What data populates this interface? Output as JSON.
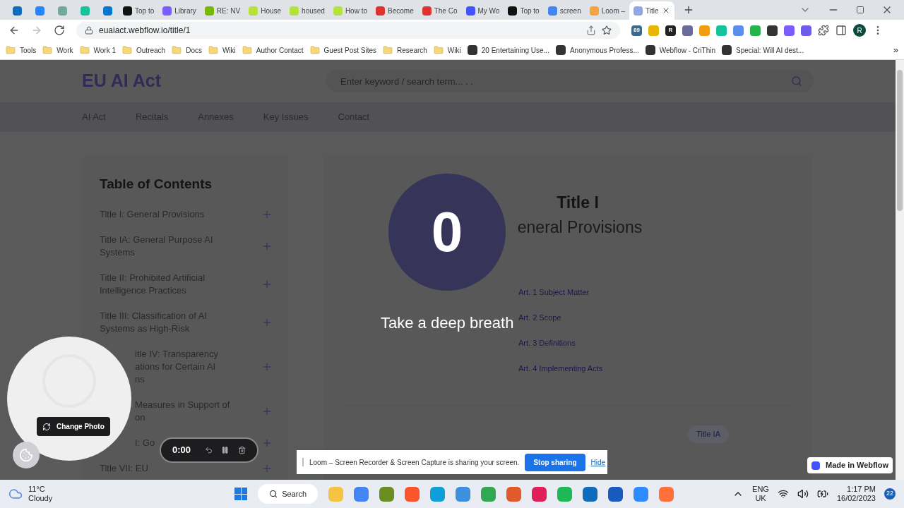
{
  "browser": {
    "tabs": [
      {
        "selected": false,
        "color": "#0f6cbd"
      },
      {
        "selected": false,
        "color": "#2684ff"
      },
      {
        "selected": false,
        "color": "#74aa9c"
      },
      {
        "selected": false,
        "color": "#15c39a"
      },
      {
        "selected": false,
        "color": "#0078d4"
      },
      {
        "label": "Top to",
        "selected": false,
        "color": "#111111"
      },
      {
        "label": "Library",
        "selected": false,
        "color": "#7c5cff"
      },
      {
        "label": "RE: NV",
        "selected": false,
        "color": "#76b900"
      },
      {
        "label": "House",
        "selected": false,
        "color": "#b7e23a"
      },
      {
        "label": "housed",
        "selected": false,
        "color": "#b7e23a"
      },
      {
        "label": "How to",
        "selected": false,
        "color": "#b7e23a"
      },
      {
        "label": "Become",
        "selected": false,
        "color": "#e0332e"
      },
      {
        "label": "The Co",
        "selected": false,
        "color": "#e0332e"
      },
      {
        "label": "My Wo",
        "selected": false,
        "color": "#4353ff"
      },
      {
        "label": "Top to",
        "selected": false,
        "color": "#111111"
      },
      {
        "label": "screen",
        "selected": false,
        "color": "#4285f4"
      },
      {
        "label": "Loom –",
        "selected": false,
        "color": "#f4a340"
      },
      {
        "label": "Title",
        "selected": true,
        "color": "#8fa6e8"
      }
    ],
    "address": "euaiact.webflow.io/title/1",
    "extensions": [
      {
        "label": "89",
        "color": "#3a6b8c"
      },
      {
        "color": "#e8b500"
      },
      {
        "label": "R",
        "color": "#222222"
      },
      {
        "color": "#6b6b9a"
      },
      {
        "color": "#f39c12"
      },
      {
        "color": "#15c39a"
      },
      {
        "color": "#5b8def"
      },
      {
        "color": "#25b34b"
      },
      {
        "color": "#333333"
      },
      {
        "color": "#7b5cff"
      },
      {
        "color": "#6c5ce7"
      }
    ],
    "profile": "R",
    "bookmarks": [
      {
        "label": "Tools",
        "kind": "folder"
      },
      {
        "label": "Work",
        "kind": "folder"
      },
      {
        "label": "Work 1",
        "kind": "folder"
      },
      {
        "label": "Outreach",
        "kind": "folder"
      },
      {
        "label": "Docs",
        "kind": "folder"
      },
      {
        "label": "Wiki",
        "kind": "folder"
      },
      {
        "label": "Author Contact",
        "kind": "folder"
      },
      {
        "label": "Guest Post Sites",
        "kind": "folder"
      },
      {
        "label": "Research",
        "kind": "folder"
      },
      {
        "label": "Wiki",
        "kind": "folder"
      },
      {
        "label": "20 Entertaining Use...",
        "kind": "site"
      },
      {
        "label": "Anonymous Profess...",
        "kind": "site"
      },
      {
        "label": "Webflow - CriThin",
        "kind": "site"
      },
      {
        "label": "Special: Will AI dest...",
        "kind": "site"
      }
    ],
    "more_bookmarks": "»"
  },
  "site": {
    "logo": "EU AI Act",
    "search": {
      "placeholder": "Enter keyword / search term... . ."
    },
    "nav": [
      "AI Act",
      "Recitals",
      "Annexes",
      "Key Issues",
      "Contact"
    ],
    "toc": {
      "title": "Table of Contents",
      "items": [
        {
          "kind": "full",
          "lines": [
            "Title I: General Provisions"
          ]
        },
        {
          "kind": "full",
          "lines": [
            "Title IA: General Purpose AI",
            "Systems"
          ]
        },
        {
          "kind": "full",
          "lines": [
            "Title II: Prohibited Artificial",
            "Intelligence Practices"
          ]
        },
        {
          "kind": "full",
          "lines": [
            "Title III: Classification of AI",
            "Systems as High-Risk"
          ]
        },
        {
          "kind": "partial",
          "lines": [
            "itle IV: Transparency",
            "ations for Certain AI",
            "ns"
          ]
        },
        {
          "kind": "partial",
          "lines": [
            "Measures in Support of",
            "on"
          ]
        },
        {
          "kind": "fragment",
          "lines": [
            "I: Go"
          ]
        },
        {
          "kind": "full",
          "lines": [
            "Title VII: EU"
          ]
        }
      ]
    },
    "article": {
      "title": "Title I",
      "subtitle": "eneral Provisions",
      "links": [
        "Art. 1 Subject Matter",
        "Art. 2 Scope",
        "Art. 3 Definitions",
        "Art. 4 Implementing Acts"
      ],
      "next": "Title IA"
    },
    "badge": "Made in Webflow"
  },
  "loom": {
    "countdown": "0",
    "message": "Take a deep breath",
    "change_photo": "Change Photo",
    "timer": "0:00",
    "banner": {
      "text": "Loom – Screen Recorder & Screen Capture is sharing your screen.",
      "stop": "Stop sharing",
      "hide": "Hide"
    }
  },
  "taskbar": {
    "weather": {
      "temp": "11°C",
      "condition": "Cloudy"
    },
    "search": "Search",
    "apps": [
      {
        "color": "#f5c242"
      },
      {
        "color": "#4285f4"
      },
      {
        "color": "#6b8e23"
      },
      {
        "color": "#fb542b"
      },
      {
        "color": "#0f9fd8"
      },
      {
        "color": "#3d8fe0"
      },
      {
        "color": "#33a853"
      },
      {
        "color": "#e05a2b"
      },
      {
        "color": "#e01e5a"
      },
      {
        "color": "#1db954"
      },
      {
        "color": "#0f6cbd"
      },
      {
        "color": "#185abd"
      },
      {
        "color": "#2d8cff"
      },
      {
        "color": "#ff7139"
      }
    ],
    "language": [
      "ENG",
      "UK"
    ],
    "time": "1:17 PM",
    "date": "16/02/2023",
    "notifications": "22"
  }
}
